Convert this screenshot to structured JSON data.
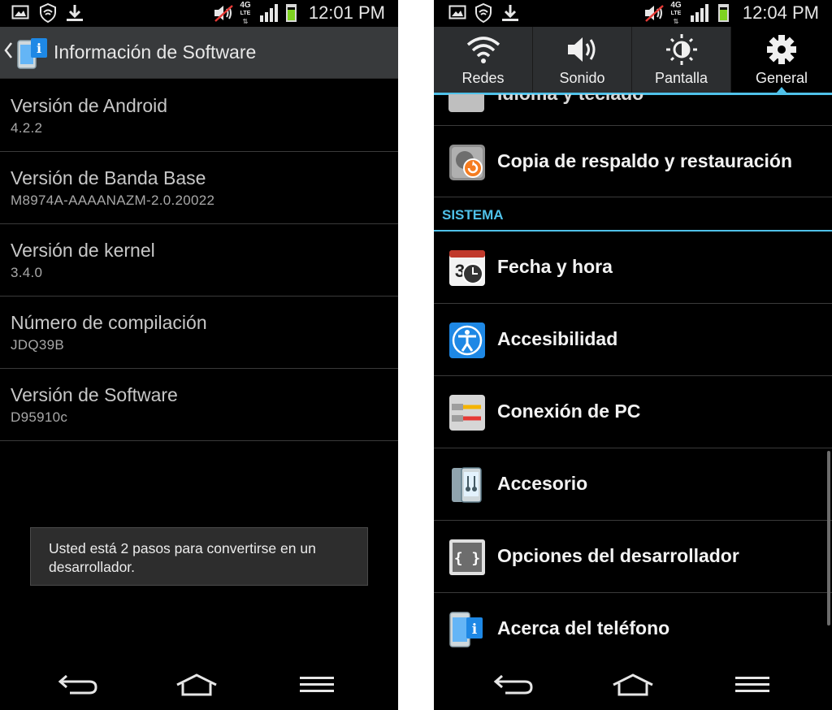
{
  "left_screen": {
    "status_bar": {
      "time": "12:01 PM",
      "network": "4G",
      "network_sub": "LTE"
    },
    "header": {
      "title": "Información de Software"
    },
    "items": [
      {
        "title": "Versión de Android",
        "value": "4.2.2"
      },
      {
        "title": "Versión de Banda Base",
        "value": "M8974A-AAAANAZM-2.0.20022"
      },
      {
        "title": "Versión de kernel",
        "value": "3.4.0"
      },
      {
        "title": "Número de compilación",
        "value": "JDQ39B"
      },
      {
        "title": "Versión de Software",
        "value": "D95910c"
      }
    ],
    "toast": {
      "line1": "Usted está 2 pasos para convertirse en un",
      "line2": "desarrollador."
    }
  },
  "right_screen": {
    "status_bar": {
      "time": "12:04 PM",
      "network": "4G",
      "network_sub": "LTE"
    },
    "tabs": [
      {
        "label": "Redes",
        "icon": "wifi-icon"
      },
      {
        "label": "Sonido",
        "icon": "speaker-icon"
      },
      {
        "label": "Pantalla",
        "icon": "brightness-icon"
      },
      {
        "label": "General",
        "icon": "gear-icon",
        "active": true
      }
    ],
    "partial_item": {
      "label": "Idioma y teclado"
    },
    "items_top": [
      {
        "label": "Copia de respaldo y restauración",
        "icon": "backup-icon"
      }
    ],
    "section": {
      "title": "SISTEMA"
    },
    "items": [
      {
        "label": "Fecha y hora",
        "icon": "calendar-clock-icon",
        "calendar_day": "3"
      },
      {
        "label": "Accesibilidad",
        "icon": "accessibility-icon"
      },
      {
        "label": "Conexión de PC",
        "icon": "pc-connection-icon"
      },
      {
        "label": "Accesorio",
        "icon": "accessory-icon"
      },
      {
        "label": "Opciones del desarrollador",
        "icon": "developer-options-icon",
        "icon_text": "{ }"
      },
      {
        "label": "Acerca del teléfono",
        "icon": "phone-info-icon"
      }
    ]
  },
  "colors": {
    "accent": "#4fc1e9",
    "battery": "#7ed321",
    "header_bg": "#383a3c",
    "tab_bg": "#2c2e30"
  },
  "status_icons": [
    "image-icon",
    "shield-icon",
    "download-icon",
    "mute-icon",
    "signal-icon",
    "battery-icon"
  ],
  "nav_buttons": [
    "back-icon",
    "home-icon",
    "menu-icon"
  ]
}
